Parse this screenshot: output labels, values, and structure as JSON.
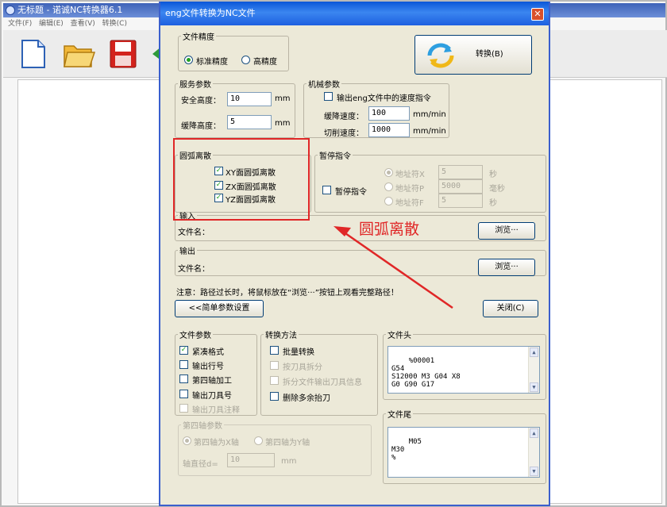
{
  "outer": {
    "title": "无标题 - 诺诚NC转换器6.1",
    "menu": "文件(F) 编辑(E) 查看(V) 转换(C)"
  },
  "dialog": {
    "title": "eng文件转换为NC文件",
    "close_label": "✕",
    "precision": {
      "legend": "文件精度",
      "standard": "标准精度",
      "high": "高精度",
      "selected": "standard"
    },
    "convert_button": "转换(B)",
    "service": {
      "legend": "服务参数",
      "safe_height_label": "安全高度：",
      "safe_height_value": "10",
      "safe_height_unit": "mm",
      "descend_label": "缓降高度：",
      "descend_value": "5",
      "descend_unit": "mm"
    },
    "machine": {
      "legend": "机械参数",
      "output_speed_label": "输出eng文件中的速度指令",
      "output_speed_checked": false,
      "descend_speed_label": "缓降速度：",
      "descend_speed_value": "100",
      "descend_speed_unit": "mm/min",
      "cut_speed_label": "切削速度：",
      "cut_speed_value": "1000",
      "cut_speed_unit": "mm/min"
    },
    "arc": {
      "legend": "圆弧离散",
      "items": [
        {
          "label": "XY面圆弧离散",
          "checked": true
        },
        {
          "label": "ZX面圆弧离散",
          "checked": true
        },
        {
          "label": "YZ面圆弧离散",
          "checked": true
        }
      ]
    },
    "pause": {
      "legend": "暂停指令",
      "checkbox_label": "暂停指令",
      "checked": false,
      "options": [
        {
          "label": "地址符X",
          "value": "5",
          "unit": "秒",
          "selected": true
        },
        {
          "label": "地址符P",
          "value": "5000",
          "unit": "毫秒",
          "selected": false
        },
        {
          "label": "地址符F",
          "value": "5",
          "unit": "秒",
          "selected": false
        }
      ]
    },
    "input": {
      "legend": "输入",
      "file_label": "文件名：",
      "browse": "浏览···"
    },
    "output": {
      "legend": "输出",
      "file_label": "文件名：",
      "browse": "浏览···"
    },
    "note": "注意：路径过长时，将鼠标放在“浏览···”按钮上观看完整路径！",
    "simple_button": "<<简单参数设置",
    "close_button": "关闭(C)",
    "file_params": {
      "legend": "文件参数",
      "items": [
        {
          "label": "紧凑格式",
          "checked": true,
          "disabled": false
        },
        {
          "label": "输出行号",
          "checked": false,
          "disabled": false
        },
        {
          "label": "第四轴加工",
          "checked": false,
          "disabled": false
        },
        {
          "label": "输出刀具号",
          "checked": false,
          "disabled": false
        },
        {
          "label": "输出刀具注释",
          "checked": false,
          "disabled": true
        }
      ]
    },
    "convert_method": {
      "legend": "转换方法",
      "items": [
        {
          "label": "批量转换",
          "checked": false,
          "disabled": false
        },
        {
          "label": "按刀具拆分",
          "checked": false,
          "disabled": true
        },
        {
          "label": "拆分文件输出刀具信息",
          "checked": false,
          "disabled": true
        },
        {
          "label": "删除多余抬刀",
          "checked": false,
          "disabled": false
        }
      ]
    },
    "file_header": {
      "legend": "文件头",
      "text": "%00001\nG54\nS12000 M3 G04 X8\nG0 G90 G17"
    },
    "file_tail": {
      "legend": "文件尾",
      "text": "M05\nM30\n%"
    },
    "fourth_axis": {
      "legend": "第四轴参数",
      "x_axis": "第四轴为X轴",
      "y_axis": "第四轴为Y轴",
      "selected": "x",
      "diameter_label": "轴直径d=",
      "diameter_value": "10",
      "diameter_unit": "mm"
    }
  },
  "annotation": {
    "text": "圆弧离散",
    "color": "#e02727"
  }
}
